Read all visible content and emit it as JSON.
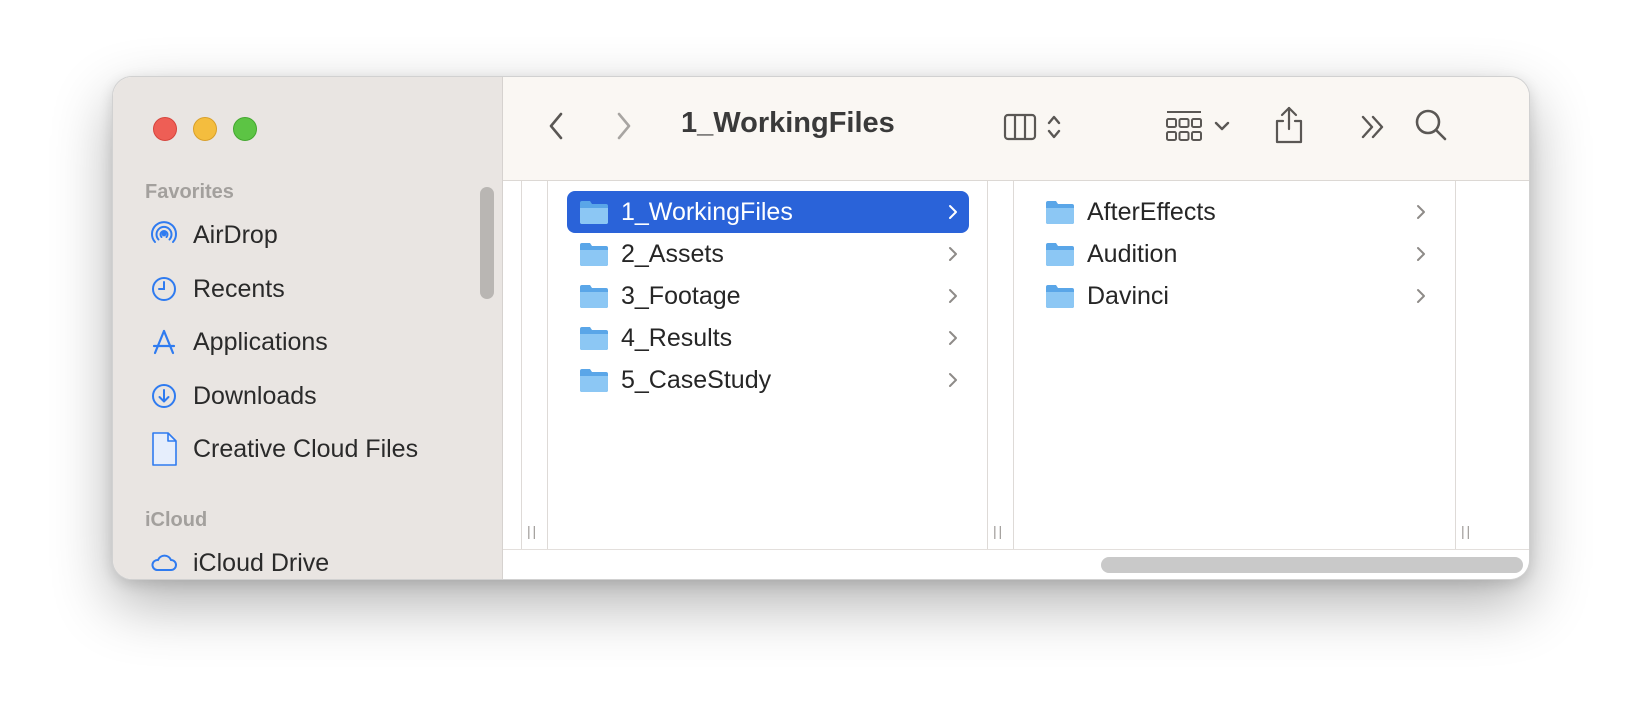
{
  "window": {
    "title": "1_WorkingFiles"
  },
  "sidebar": {
    "favorites_title": "Favorites",
    "icloud_title": "iCloud",
    "items": [
      {
        "label": "AirDrop",
        "icon": "airdrop-icon"
      },
      {
        "label": "Recents",
        "icon": "clock-icon"
      },
      {
        "label": "Applications",
        "icon": "applications-icon"
      },
      {
        "label": "Downloads",
        "icon": "download-icon"
      },
      {
        "label": "Creative Cloud Files",
        "icon": "document-icon"
      }
    ],
    "partial_item": "iCloud Drive"
  },
  "column1": {
    "items": [
      {
        "label": "1_WorkingFiles",
        "selected": true
      },
      {
        "label": "2_Assets",
        "selected": false
      },
      {
        "label": "3_Footage",
        "selected": false
      },
      {
        "label": "4_Results",
        "selected": false
      },
      {
        "label": "5_CaseStudy",
        "selected": false
      }
    ]
  },
  "column2": {
    "items": [
      {
        "label": "AfterEffects"
      },
      {
        "label": "Audition"
      },
      {
        "label": "Davinci"
      }
    ]
  },
  "colors": {
    "accent": "#2a63d9",
    "sidebar_bg": "#e9e5e2",
    "icon_blue": "#2f7bf0",
    "folder_blue": "#6fb6ef"
  }
}
